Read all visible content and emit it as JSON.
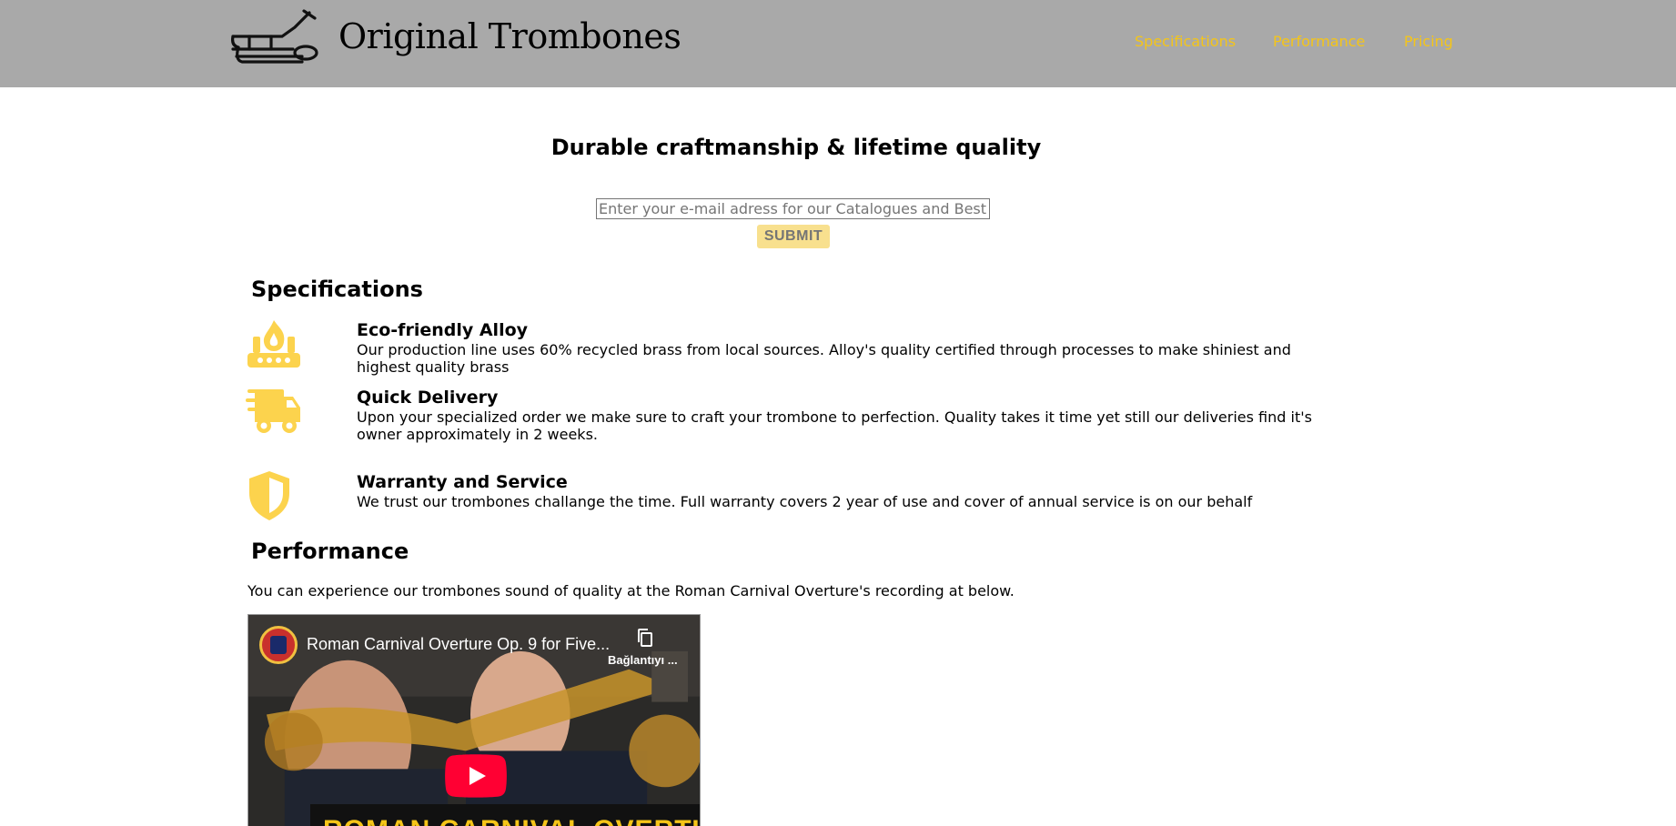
{
  "header": {
    "brand": "Original Trombones",
    "nav": [
      "Specifications",
      "Performance",
      "Pricing"
    ]
  },
  "hero": {
    "title": "Durable craftmanship & lifetime quality",
    "email_placeholder": "Enter your e-mail adress for our Catalogues and Best prices",
    "submit_label": "SUBMIT"
  },
  "specifications": {
    "title": "Specifications",
    "items": [
      {
        "icon": "fire-icon",
        "title": "Eco-friendly Alloy",
        "text": "Our production line uses 60% recycled brass from local sources. Alloy's quality certified through processes to make shiniest and highest quality brass"
      },
      {
        "icon": "truck-icon",
        "title": "Quick Delivery",
        "text": "Upon your specialized order we make sure to craft your trombone to perfection. Quality takes it time yet still our deliveries find it's owner approximately in 2 weeks."
      },
      {
        "icon": "shield-icon",
        "title": "Warranty and Service",
        "text": "We trust our trombones challange the time. Full warranty covers 2 year of use and cover of annual service is on our behalf"
      }
    ]
  },
  "performance": {
    "title": "Performance",
    "text": "You can experience our trombones sound of quality at the Roman Carnival Overture's recording at below.",
    "video": {
      "title": "Roman Carnival Overture Op. 9 for Five...",
      "copy_label": "Bağlantıyı ...",
      "banner": "ROMAN CARNIVAL OVERTURE"
    }
  },
  "colors": {
    "header_bg": "#a9a9a9",
    "accent": "#f5c518",
    "submit_bg": "#f8e08e",
    "icon_yellow": "#fcd34d"
  }
}
